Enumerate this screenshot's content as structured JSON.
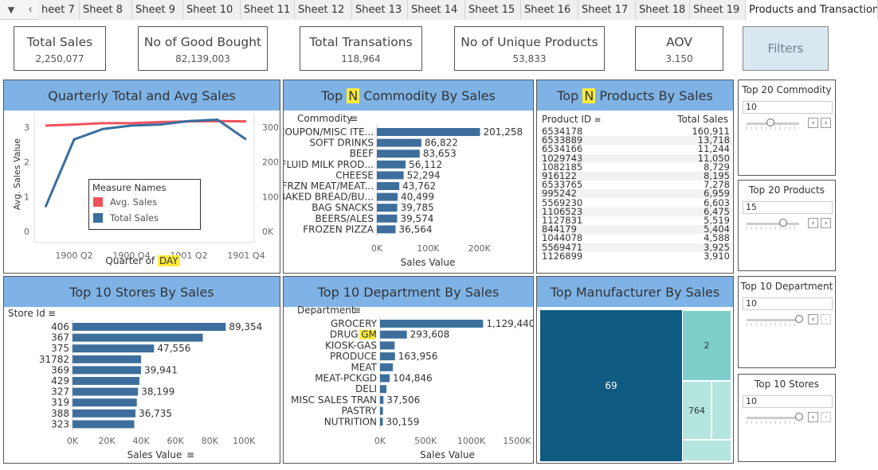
{
  "tabs": [
    "heet 7",
    "Sheet 8",
    "Sheet 9",
    "Sheet 10",
    "Sheet 11",
    "Sheet 12",
    "Sheet 13",
    "Sheet 14",
    "Sheet 15",
    "Sheet 16",
    "Sheet 17",
    "Sheet 18",
    "Sheet 19",
    "Products and Transaction"
  ],
  "kpis": [
    {
      "title": "Total Sales",
      "value": "2,250,077"
    },
    {
      "title": "No of Good Bought",
      "value": "82,139,003"
    },
    {
      "title": "Total Transations",
      "value": "118,964"
    },
    {
      "title": "No of Unique Products",
      "value": "53,833"
    },
    {
      "title": "AOV",
      "value": "3.150"
    }
  ],
  "filters_label": "Filters",
  "quarterly": {
    "title": "Quarterly Total and Avg Sales",
    "ylabel": "Avg. Sales Value",
    "xlabel_prefix": "Quarter of",
    "xlabel_hl": "DAY",
    "legend_title": "Measure Names",
    "legend": [
      {
        "name": "Avg. Sales",
        "color": "#f0525c"
      },
      {
        "name": "Total Sales",
        "color": "#3a6f9e"
      }
    ]
  },
  "commodity": {
    "title_pre": "Top",
    "title_hl": "N",
    "title_post": "Commodity By Sales",
    "col": "Commodity",
    "xlabel": "Sales Value"
  },
  "products": {
    "title_pre": "Top",
    "title_hl": "N",
    "title_post": "Products By Sales",
    "col1": "Product ID",
    "col2": "Total Sales",
    "rows": [
      [
        "6534178",
        "160,911"
      ],
      [
        "6533889",
        "13,718"
      ],
      [
        "6534166",
        "11,244"
      ],
      [
        "1029743",
        "11,050"
      ],
      [
        "1082185",
        "8,729"
      ],
      [
        "916122",
        "8,195"
      ],
      [
        "6533765",
        "7,278"
      ],
      [
        "995242",
        "6,959"
      ],
      [
        "5569230",
        "6,603"
      ],
      [
        "1106523",
        "6,475"
      ],
      [
        "1127831",
        "5,519"
      ],
      [
        "844179",
        "5,404"
      ],
      [
        "1044078",
        "4,588"
      ],
      [
        "5569471",
        "3,925"
      ],
      [
        "1126899",
        "3,910"
      ]
    ]
  },
  "stores": {
    "title": "Top 10 Stores By Sales",
    "col": "Store Id",
    "xlabel": "Sales Value"
  },
  "department": {
    "title": "Top 10 Department By Sales",
    "col": "Department",
    "xlabel": "Sales Value",
    "hl_label": "GM"
  },
  "manufacturer": {
    "title": "Top Manufacturer By Sales",
    "labels": [
      "69",
      "2",
      "764"
    ],
    "colors": {
      "dark": "#0f5a80",
      "mid": "#7ecfcc",
      "light": "#b4e5de"
    }
  },
  "filter_widgets": [
    {
      "title": "Top 20 Commodity",
      "value": "10",
      "level": 0.45
    },
    {
      "title": "Top 20 Products",
      "value": "15",
      "level": 0.7
    },
    {
      "title": "Top 10 Department",
      "value": "10",
      "level": 1.0
    },
    {
      "title": "Top 10 Stores",
      "value": "10",
      "level": 1.0
    }
  ],
  "chart_data": [
    {
      "type": "line",
      "title": "Quarterly Total and Avg Sales",
      "x": [
        "1900 Q1",
        "1900 Q2",
        "1900 Q3",
        "1900 Q4",
        "1901 Q1",
        "1901 Q2",
        "1901 Q3",
        "1901 Q4"
      ],
      "x_ticks": [
        "1900 Q2",
        "1900 Q4",
        "1901 Q2",
        "1901 Q4"
      ],
      "xlabel": "Quarter of DAY",
      "ylabel": "Avg. Sales Value",
      "series": [
        {
          "name": "Avg. Sales",
          "axis": "left",
          "values": [
            3.05,
            3.08,
            3.12,
            3.12,
            3.15,
            3.17,
            3.18,
            3.17
          ]
        },
        {
          "name": "Total Sales",
          "axis": "right",
          "values": [
            70000,
            265000,
            295000,
            305000,
            308000,
            318000,
            322000,
            265000
          ]
        }
      ],
      "ylim_left": [
        0,
        3.3
      ],
      "yticks_left": [
        0,
        1,
        2,
        3
      ],
      "ylim_right": [
        0,
        330000
      ],
      "yticks_right": [
        "0K",
        "100K",
        "200K",
        "300K"
      ],
      "legend": "center-left"
    },
    {
      "type": "bar",
      "title": "Top N Commodity By Sales",
      "categories": [
        "COUPON/MISC ITE...",
        "SOFT DRINKS",
        "BEEF",
        "FLUID MILK PROD...",
        "CHEESE",
        "FRZN MEAT/MEAT...",
        "BAKED BREAD/BU...",
        "BAG SNACKS",
        "BEERS/ALES",
        "FROZEN PIZZA"
      ],
      "values": [
        201258,
        86822,
        83653,
        56112,
        52294,
        43762,
        40499,
        39785,
        39574,
        36564
      ],
      "labels": [
        "201,258",
        "86,822",
        "83,653",
        "56,112",
        "52,294",
        "43,762",
        "40,499",
        "39,785",
        "39,574",
        "36,564"
      ],
      "xticks": [
        "0K",
        "100K",
        "200K"
      ],
      "xlim": [
        0,
        230000
      ],
      "xlabel": "Sales Value"
    },
    {
      "type": "table",
      "title": "Top N Products By Sales",
      "columns": [
        "Product ID",
        "Total Sales"
      ]
    },
    {
      "type": "bar",
      "title": "Top 10 Stores By Sales",
      "categories": [
        "406",
        "367",
        "375",
        "31782",
        "369",
        "429",
        "327",
        "319",
        "388",
        "323"
      ],
      "values": [
        89354,
        76000,
        47556,
        40000,
        39941,
        39000,
        38199,
        37500,
        36735,
        36000
      ],
      "labels": [
        "89,354",
        "",
        "47,556",
        "",
        "39,941",
        "",
        "38,199",
        "",
        "36,735",
        ""
      ],
      "xticks": [
        "0K",
        "20K",
        "40K",
        "60K",
        "80K",
        "100K"
      ],
      "xlim": [
        0,
        105000
      ],
      "xlabel": "Sales Value"
    },
    {
      "type": "bar",
      "title": "Top 10 Department By Sales",
      "categories": [
        "GROCERY",
        "DRUG GM",
        "KIOSK-GAS",
        "PRODUCE",
        "MEAT",
        "MEAT-PCKGD",
        "DELI",
        "MISC SALES TRAN",
        "PASTRY",
        "NUTRITION"
      ],
      "values": [
        1129440,
        293608,
        160000,
        163956,
        140000,
        104846,
        70000,
        37506,
        32000,
        30159
      ],
      "labels": [
        "1,129,440",
        "293,608",
        "",
        "163,956",
        "",
        "104,846",
        "",
        "37,506",
        "",
        "30,159"
      ],
      "xticks": [
        "0K",
        "500K",
        "1000K",
        "1500K"
      ],
      "xlim": [
        0,
        1650000
      ],
      "xlabel": "Sales Value"
    }
  ]
}
